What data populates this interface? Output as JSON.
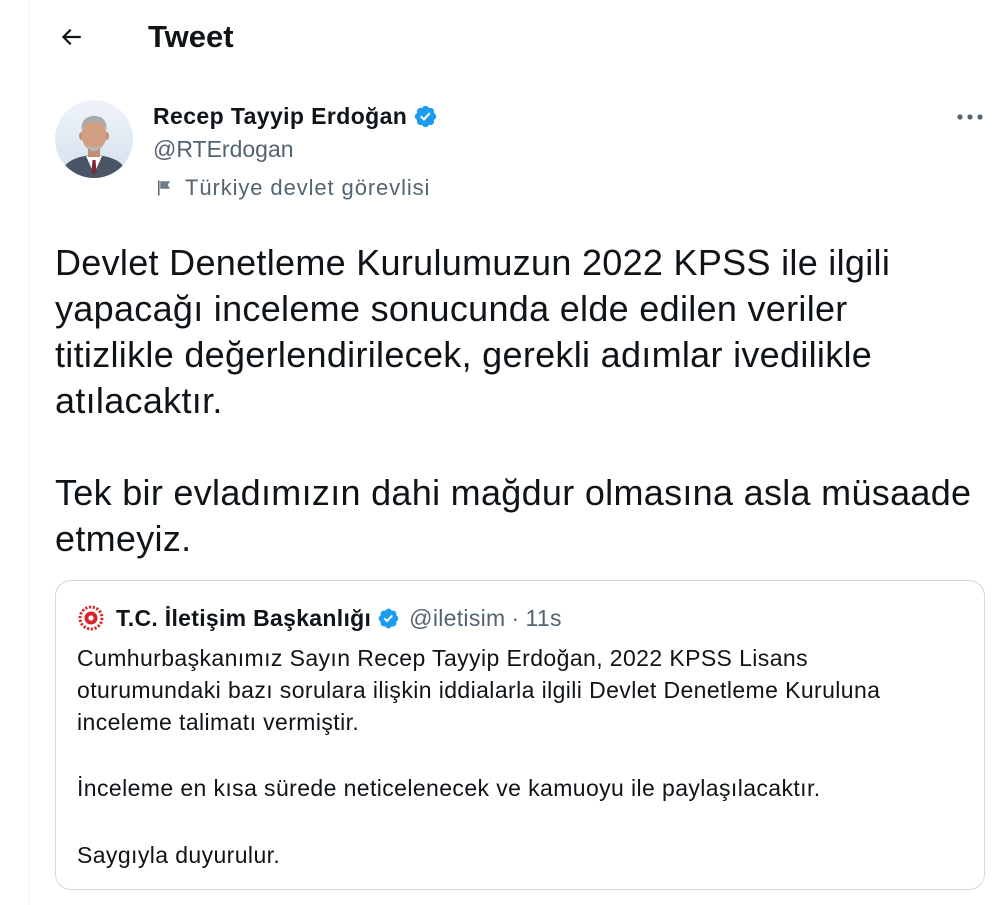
{
  "header": {
    "title": "Tweet",
    "back_icon": "back-arrow-icon"
  },
  "colors": {
    "text": "#0f1419",
    "secondary": "#536471",
    "accent": "#1d9bf0",
    "border": "#cfd9de",
    "divider": "#eff3f4",
    "logo_red": "#d7262b"
  },
  "tweet": {
    "author": {
      "name": "Recep Tayyip Erdoğan",
      "handle": "@RTErdogan",
      "verified": true,
      "verified_icon": "verified-badge-icon",
      "avatar_icon": "profile-photo",
      "label_icon": "flag-icon",
      "label": "Türkiye devlet görevlisi"
    },
    "more_icon": "more-options-icon",
    "paragraphs": [
      {
        "lines": [
          "Devlet Denetleme Kurulumuzun 2022 KPSS ile ilgili",
          "yapacağı inceleme sonucunda elde edilen veriler",
          "titizlikle değerlendirilecek, gerekli adımlar ivedilikle",
          "atılacaktır."
        ]
      },
      {
        "lines": [
          "Tek bir evladımızın dahi mağdur olmasına asla müsaade",
          "etmeyiz."
        ]
      }
    ],
    "quoted": {
      "logo_icon": "organization-emblem-icon",
      "author_name": "T.C. İletişim Başkanlığı",
      "verified": true,
      "handle": "@iletisim",
      "separator": "·",
      "time": "11s",
      "paragraphs": [
        {
          "lines": [
            "Cumhurbaşkanımız Sayın Recep Tayyip Erdoğan, 2022 KPSS Lisans",
            "oturumundaki bazı sorulara ilişkin iddialarla ilgili Devlet Denetleme Kuruluna",
            "inceleme talimatı vermiştir."
          ]
        },
        {
          "lines": [
            "İnceleme en kısa sürede neticelenecek ve kamuoyu ile paylaşılacaktır."
          ]
        },
        {
          "lines": [
            "Saygıyla duyurulur."
          ]
        }
      ]
    }
  }
}
